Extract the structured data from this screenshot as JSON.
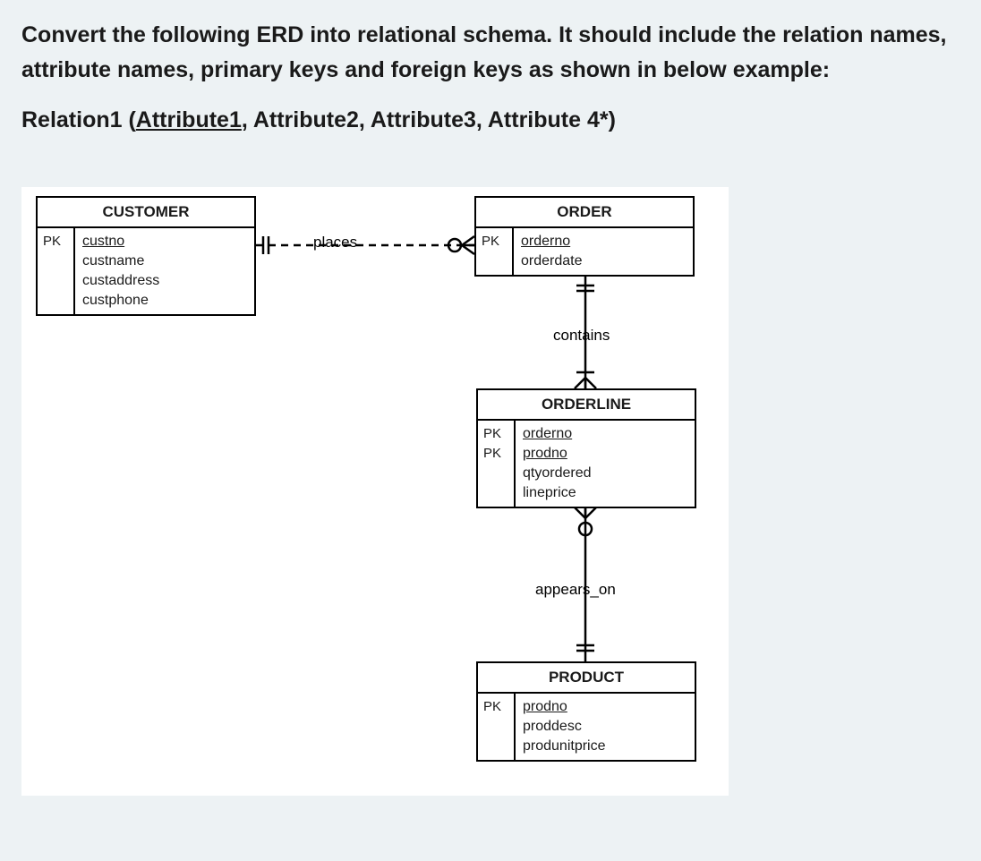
{
  "question": {
    "prompt": "Convert the following ERD into relational schema. It should include the relation names, attribute names, primary keys and foreign keys as shown in below example:",
    "example_relation_prefix": "Relation1 (",
    "example_pk": "Attribute1",
    "example_comma": ",",
    "example_rest": " Attribute2, Attribute3, Attribute 4*)"
  },
  "entities": {
    "customer": {
      "name": "CUSTOMER",
      "pk_labels": [
        "PK"
      ],
      "attrs": [
        {
          "name": "custno",
          "pk": true
        },
        {
          "name": "custname",
          "pk": false
        },
        {
          "name": "custaddress",
          "pk": false
        },
        {
          "name": "custphone",
          "pk": false
        }
      ]
    },
    "order": {
      "name": "ORDER",
      "pk_labels": [
        "PK"
      ],
      "attrs": [
        {
          "name": "orderno",
          "pk": true
        },
        {
          "name": "orderdate",
          "pk": false
        }
      ]
    },
    "orderline": {
      "name": "ORDERLINE",
      "pk_labels": [
        "PK",
        "PK"
      ],
      "attrs": [
        {
          "name": "orderno",
          "pk": true
        },
        {
          "name": "prodno",
          "pk": true
        },
        {
          "name": "qtyordered",
          "pk": false
        },
        {
          "name": "lineprice",
          "pk": false
        }
      ]
    },
    "product": {
      "name": "PRODUCT",
      "pk_labels": [
        "PK"
      ],
      "attrs": [
        {
          "name": "prodno",
          "pk": true
        },
        {
          "name": "proddesc",
          "pk": false
        },
        {
          "name": "produnitprice",
          "pk": false
        }
      ]
    }
  },
  "relationships": {
    "places": "places",
    "contains": "contains",
    "appears_on": "appears_on"
  }
}
